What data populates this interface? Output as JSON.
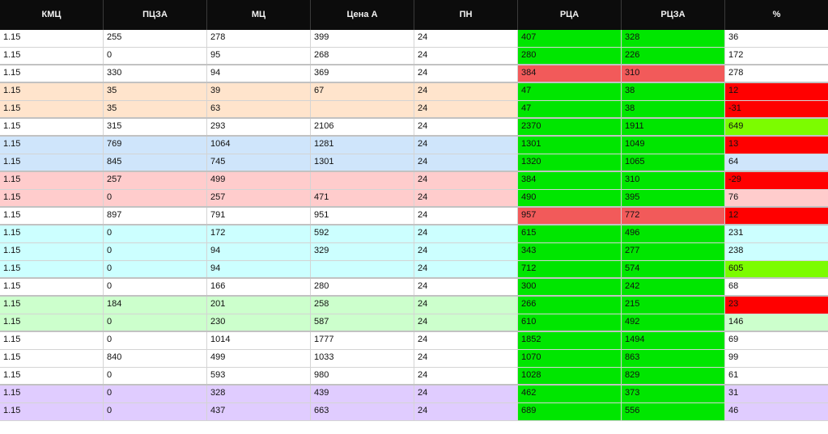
{
  "colors": {
    "header_bg": "#0c0c0c",
    "header_text": "#f2f2f2",
    "green": "#00e600",
    "light_red": "#f25a5a",
    "red": "#ff0000",
    "lime": "#7cfc00",
    "group_white": "#ffffff",
    "group_peach": "#ffe4cc",
    "group_blue": "#cfe5fb",
    "group_pink": "#ffcccc",
    "group_cyan": "#ccffff",
    "group_mint": "#ccffcc",
    "group_lavender": "#e0ccff"
  },
  "columns": [
    "КМЦ",
    "ПЦЗА",
    "МЦ",
    "Цена А",
    "ПН",
    "РЦА",
    "РЦЗА",
    "%"
  ],
  "rows": [
    {
      "group": "group_white",
      "cells": [
        "1.15",
        "255",
        "278",
        "399",
        "24",
        "407",
        "328",
        "36"
      ],
      "hl": {
        "5": "green",
        "6": "green"
      }
    },
    {
      "group": "group_white",
      "cells": [
        "1.15",
        "0",
        "95",
        "268",
        "24",
        "280",
        "226",
        "172"
      ],
      "hl": {
        "5": "green",
        "6": "green"
      },
      "sep": true
    },
    {
      "group": "group_white",
      "cells": [
        "1.15",
        "330",
        "94",
        "369",
        "24",
        "384",
        "310",
        "278"
      ],
      "hl": {
        "5": "light_red",
        "6": "light_red"
      },
      "sep": true
    },
    {
      "group": "group_peach",
      "cells": [
        "1.15",
        "35",
        "39",
        "67",
        "24",
        "47",
        "38",
        "12"
      ],
      "hl": {
        "5": "green",
        "6": "green",
        "7": "red"
      }
    },
    {
      "group": "group_peach",
      "cells": [
        "1.15",
        "35",
        "63",
        "",
        "24",
        "47",
        "38",
        "-31"
      ],
      "hl": {
        "5": "green",
        "6": "green",
        "7": "red"
      },
      "sep": true
    },
    {
      "group": "group_white",
      "cells": [
        "1.15",
        "315",
        "293",
        "2106",
        "24",
        "2370",
        "1911",
        "649"
      ],
      "hl": {
        "5": "green",
        "6": "green",
        "7": "lime"
      },
      "sep": true
    },
    {
      "group": "group_blue",
      "cells": [
        "1.15",
        "769",
        "1064",
        "1281",
        "24",
        "1301",
        "1049",
        "13"
      ],
      "hl": {
        "5": "green",
        "6": "green",
        "7": "red"
      }
    },
    {
      "group": "group_blue",
      "cells": [
        "1.15",
        "845",
        "745",
        "1301",
        "24",
        "1320",
        "1065",
        "64"
      ],
      "hl": {
        "5": "green",
        "6": "green"
      },
      "sep": true
    },
    {
      "group": "group_pink",
      "cells": [
        "1.15",
        "257",
        "499",
        "",
        "24",
        "384",
        "310",
        "-29"
      ],
      "hl": {
        "5": "green",
        "6": "green",
        "7": "red"
      }
    },
    {
      "group": "group_pink",
      "cells": [
        "1.15",
        "0",
        "257",
        "471",
        "24",
        "490",
        "395",
        "76"
      ],
      "hl": {
        "5": "green",
        "6": "green"
      },
      "sep": true
    },
    {
      "group": "group_white",
      "cells": [
        "1.15",
        "897",
        "791",
        "951",
        "24",
        "957",
        "772",
        "12"
      ],
      "hl": {
        "5": "light_red",
        "6": "light_red",
        "7": "red"
      },
      "sep": true
    },
    {
      "group": "group_cyan",
      "cells": [
        "1.15",
        "0",
        "172",
        "592",
        "24",
        "615",
        "496",
        "231"
      ],
      "hl": {
        "5": "green",
        "6": "green"
      }
    },
    {
      "group": "group_cyan",
      "cells": [
        "1.15",
        "0",
        "94",
        "329",
        "24",
        "343",
        "277",
        "238"
      ],
      "hl": {
        "5": "green",
        "6": "green"
      }
    },
    {
      "group": "group_cyan",
      "cells": [
        "1.15",
        "0",
        "94",
        "",
        "24",
        "712",
        "574",
        "605"
      ],
      "hl": {
        "5": "green",
        "6": "green",
        "7": "lime"
      },
      "sep": true
    },
    {
      "group": "group_white",
      "cells": [
        "1.15",
        "0",
        "166",
        "280",
        "24",
        "300",
        "242",
        "68"
      ],
      "hl": {
        "5": "green",
        "6": "green"
      },
      "sep": true
    },
    {
      "group": "group_mint",
      "cells": [
        "1.15",
        "184",
        "201",
        "258",
        "24",
        "266",
        "215",
        "23"
      ],
      "hl": {
        "5": "green",
        "6": "green",
        "7": "red"
      }
    },
    {
      "group": "group_mint",
      "cells": [
        "1.15",
        "0",
        "230",
        "587",
        "24",
        "610",
        "492",
        "146"
      ],
      "hl": {
        "5": "green",
        "6": "green"
      },
      "sep": true
    },
    {
      "group": "group_white",
      "cells": [
        "1.15",
        "0",
        "1014",
        "1777",
        "24",
        "1852",
        "1494",
        "69"
      ],
      "hl": {
        "5": "green",
        "6": "green"
      }
    },
    {
      "group": "group_white",
      "cells": [
        "1.15",
        "840",
        "499",
        "1033",
        "24",
        "1070",
        "863",
        "99"
      ],
      "hl": {
        "5": "green",
        "6": "green"
      }
    },
    {
      "group": "group_white",
      "cells": [
        "1.15",
        "0",
        "593",
        "980",
        "24",
        "1028",
        "829",
        "61"
      ],
      "hl": {
        "5": "green",
        "6": "green"
      },
      "sep": true
    },
    {
      "group": "group_lavender",
      "cells": [
        "1.15",
        "0",
        "328",
        "439",
        "24",
        "462",
        "373",
        "31"
      ],
      "hl": {
        "5": "green",
        "6": "green"
      }
    },
    {
      "group": "group_lavender",
      "cells": [
        "1.15",
        "0",
        "437",
        "663",
        "24",
        "689",
        "556",
        "46"
      ],
      "hl": {
        "5": "green",
        "6": "green"
      }
    }
  ]
}
